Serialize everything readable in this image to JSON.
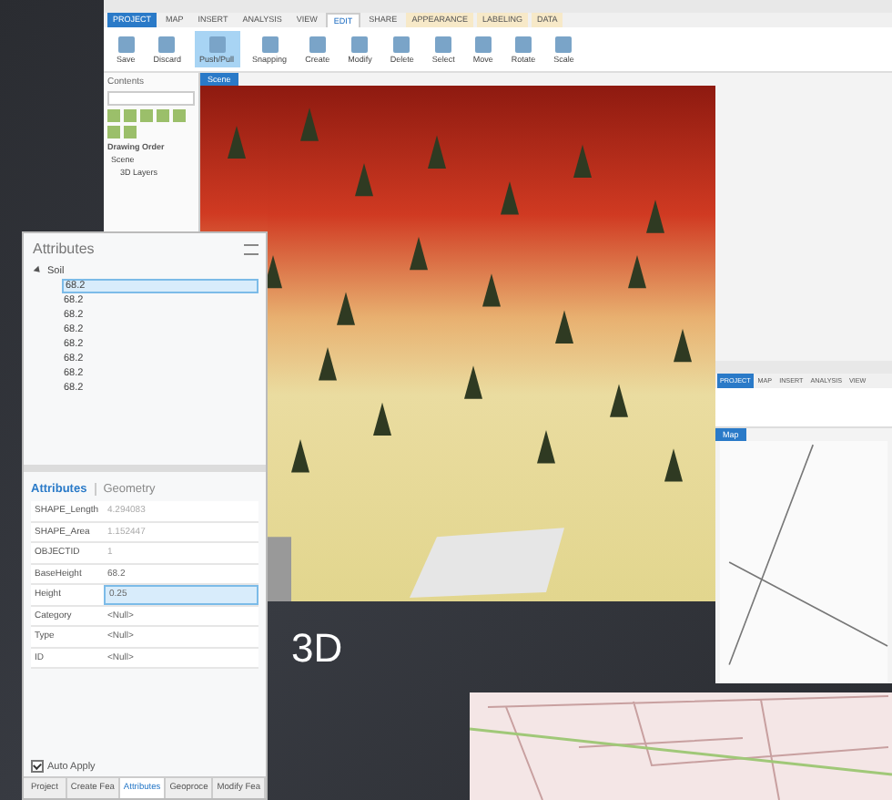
{
  "main_window": {
    "ribbon_tabs": [
      {
        "label": "PROJECT",
        "selected": false,
        "kind": "backstage"
      },
      {
        "label": "MAP",
        "selected": false,
        "kind": "core"
      },
      {
        "label": "INSERT",
        "selected": false,
        "kind": "core"
      },
      {
        "label": "ANALYSIS",
        "selected": false,
        "kind": "core"
      },
      {
        "label": "VIEW",
        "selected": false,
        "kind": "core"
      },
      {
        "label": "EDIT",
        "selected": true,
        "kind": "core"
      },
      {
        "label": "SHARE",
        "selected": false,
        "kind": "core"
      },
      {
        "label": "APPEARANCE",
        "selected": false,
        "kind": "context"
      },
      {
        "label": "LABELING",
        "selected": false,
        "kind": "context"
      },
      {
        "label": "DATA",
        "selected": false,
        "kind": "context"
      }
    ],
    "ribbon_buttons": [
      {
        "label": "Save",
        "selected": false
      },
      {
        "label": "Discard",
        "selected": false
      },
      {
        "label": "Push/Pull",
        "selected": true
      },
      {
        "label": "Snapping",
        "selected": false
      },
      {
        "label": "Create",
        "selected": false
      },
      {
        "label": "Modify",
        "selected": false
      },
      {
        "label": "Delete",
        "selected": false
      },
      {
        "label": "Select",
        "selected": false
      },
      {
        "label": "Move",
        "selected": false
      },
      {
        "label": "Rotate",
        "selected": false
      },
      {
        "label": "Scale",
        "selected": false
      }
    ],
    "contents": {
      "title": "Contents",
      "heading": "Drawing Order",
      "tree": [
        {
          "label": "Scene",
          "children": [
            {
              "label": "3D Layers"
            }
          ]
        }
      ]
    },
    "view_tab": "Scene"
  },
  "attributes": {
    "title": "Attributes",
    "layer": {
      "label": "Soil",
      "expanded": true
    },
    "features": [
      {
        "label": "68.2",
        "selected": true
      },
      {
        "label": "68.2",
        "selected": false
      },
      {
        "label": "68.2",
        "selected": false
      },
      {
        "label": "68.2",
        "selected": false
      },
      {
        "label": "68.2",
        "selected": false
      },
      {
        "label": "68.2",
        "selected": false
      },
      {
        "label": "68.2",
        "selected": false
      },
      {
        "label": "68.2",
        "selected": false
      }
    ],
    "tabs": [
      {
        "label": "Attributes",
        "selected": true
      },
      {
        "label": "Geometry",
        "selected": false
      }
    ],
    "fields": [
      {
        "name": "SHAPE_Length",
        "value": "4.294083",
        "editable": false,
        "selected": false
      },
      {
        "name": "SHAPE_Area",
        "value": "1.152447",
        "editable": false,
        "selected": false
      },
      {
        "name": "OBJECTID",
        "value": "1",
        "editable": false,
        "selected": false
      },
      {
        "name": "BaseHeight",
        "value": "68.2",
        "editable": true,
        "selected": false
      },
      {
        "name": "Height",
        "value": "0.25",
        "editable": true,
        "selected": true
      },
      {
        "name": "Category",
        "value": "<Null>",
        "editable": true,
        "selected": false
      },
      {
        "name": "Type",
        "value": "<Null>",
        "editable": true,
        "selected": false
      },
      {
        "name": "ID",
        "value": "<Null>",
        "editable": true,
        "selected": false
      }
    ],
    "auto_apply": {
      "label": "Auto Apply",
      "checked": true
    },
    "bottom_tabs": [
      {
        "label": "Project",
        "selected": false
      },
      {
        "label": "Create Fea",
        "selected": false
      },
      {
        "label": "Attributes",
        "selected": true
      },
      {
        "label": "Geoproce",
        "selected": false
      },
      {
        "label": "Modify Fea",
        "selected": false
      }
    ]
  },
  "caption": "3D",
  "second_window": {
    "ribbon_tabs": [
      {
        "label": "PROJECT",
        "selected": false,
        "kind": "backstage"
      },
      {
        "label": "MAP",
        "selected": false,
        "kind": "core"
      },
      {
        "label": "INSERT",
        "selected": false,
        "kind": "core"
      },
      {
        "label": "ANALYSIS",
        "selected": false,
        "kind": "core"
      },
      {
        "label": "VIEW",
        "selected": false,
        "kind": "core"
      }
    ],
    "view_tab": "Map"
  }
}
